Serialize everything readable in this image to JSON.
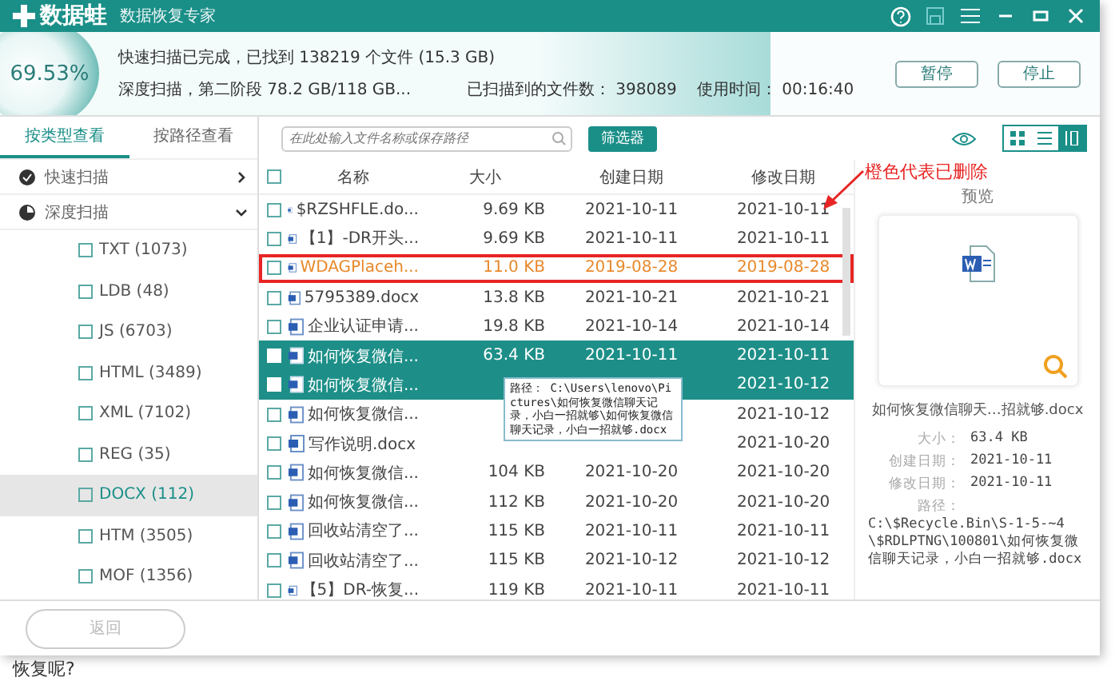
{
  "app": {
    "name": "数据蛙",
    "subtitle": "数据恢复专家"
  },
  "scan": {
    "percent": "69.53%",
    "level": 0.7,
    "line_1": "快速扫描已完成，已找到 138219 个文件 (15.3 GB)",
    "line_2": "深度扫描，第二阶段 78.2 GB/118 GB...",
    "files_scanned": "已扫描到的文件数： 398089",
    "time_used": "使用时间： 00:16:40",
    "buttons": [
      "暂停",
      "停止"
    ]
  },
  "sidebar": {
    "tabs": [
      {
        "label": "按类型查看",
        "selected": true
      },
      {
        "label": "按路径查看",
        "selected": false
      }
    ],
    "tree": [
      {
        "label": "快速扫描",
        "kind": "done",
        "expanded": false
      },
      {
        "label": "深度扫描",
        "kind": "progress",
        "expanded": true,
        "children": [
          {
            "label": "TXT (1073)",
            "selected": false
          },
          {
            "label": "LDB (48)",
            "selected": false
          },
          {
            "label": "JS (6703)",
            "selected": false
          },
          {
            "label": "HTML (3489)",
            "selected": false
          },
          {
            "label": "XML (7102)",
            "selected": false
          },
          {
            "label": "REG (35)",
            "selected": false
          },
          {
            "label": "DOCX (112)",
            "selected": true
          },
          {
            "label": "HTM (3505)",
            "selected": false
          },
          {
            "label": "MOF (1356)",
            "selected": false
          }
        ]
      }
    ]
  },
  "toolbar": {
    "search": {
      "placeholder": "在此处输入文件名称或保存路径"
    },
    "filter": "筛选器",
    "views": [
      {
        "kind": "grid",
        "selected": false
      },
      {
        "kind": "list",
        "selected": false
      },
      {
        "kind": "preview",
        "selected": true
      }
    ]
  },
  "table": {
    "select_all": {
      "checked": false
    },
    "columns": [
      "名称",
      "大小",
      "创建日期",
      "修改日期"
    ],
    "rows": [
      {
        "name": "$RZSHFLE.do...",
        "size": "9.69 KB",
        "created": "2021-10-11",
        "modified": "2021-10-11",
        "selected": false,
        "deleted": false,
        "annotated": false
      },
      {
        "name": "【1】-DR开头...",
        "size": "9.69 KB",
        "created": "2021-10-11",
        "modified": "2021-10-11",
        "selected": false,
        "deleted": false,
        "annotated": false
      },
      {
        "name": "WDAGPlaceh...",
        "size": "11.0 KB",
        "created": "2019-08-28",
        "modified": "2019-08-28",
        "selected": false,
        "deleted": true,
        "annotated": true
      },
      {
        "name": "5795389.docx",
        "size": "13.8 KB",
        "created": "2021-10-21",
        "modified": "2021-10-21",
        "selected": false,
        "deleted": false,
        "annotated": false
      },
      {
        "name": "企业认证申请...",
        "size": "19.8 KB",
        "created": "2021-10-14",
        "modified": "2021-10-14",
        "selected": false,
        "deleted": false,
        "annotated": false
      },
      {
        "name": "如何恢复微信...",
        "size": "63.4 KB",
        "created": "2021-10-11",
        "modified": "2021-10-11",
        "selected": true,
        "deleted": false,
        "annotated": false
      },
      {
        "name": "如何恢复微信...",
        "modified": "2021-10-12",
        "selected": true,
        "deleted": false,
        "annotated": false
      },
      {
        "name": "如何恢复微信...",
        "modified": "2021-10-12",
        "selected": false,
        "deleted": false,
        "annotated": false
      },
      {
        "name": "写作说明.docx",
        "modified": "2021-10-20",
        "selected": false,
        "deleted": false,
        "annotated": false
      },
      {
        "name": "如何恢复微信...",
        "size": "104 KB",
        "created": "2021-10-20",
        "modified": "2021-10-20",
        "selected": false,
        "deleted": false,
        "annotated": false
      },
      {
        "name": "如何恢复微信...",
        "size": "112 KB",
        "created": "2021-10-20",
        "modified": "2021-10-20",
        "selected": false,
        "deleted": false,
        "annotated": false
      },
      {
        "name": "回收站清空了...",
        "size": "115 KB",
        "created": "2021-10-11",
        "modified": "2021-10-11",
        "selected": false,
        "deleted": false,
        "annotated": false
      },
      {
        "name": "回收站清空了...",
        "size": "115 KB",
        "created": "2021-10-12",
        "modified": "2021-10-12",
        "selected": false,
        "deleted": false,
        "annotated": false
      },
      {
        "name": "【5】DR-恢复...",
        "size": "119 KB",
        "created": "2021-10-11",
        "modified": "2021-10-11",
        "selected": false,
        "deleted": false,
        "annotated": false
      }
    ],
    "tooltip": "路径： C:\\Users\\lenovo\\Pictures\\如何恢复微信聊天记录，小白一招就够\\如何恢复微信聊天记录，小白一招就够.docx"
  },
  "annotation": "橙色代表已删除",
  "preview": {
    "title": "预览",
    "filename": "如何恢复微信聊天…招就够.docx",
    "details": [
      {
        "label": "大小：",
        "value": "63.4 KB"
      },
      {
        "label": "创建日期：",
        "value": "2021-10-11"
      },
      {
        "label": "修改日期：",
        "value": "2021-10-11"
      }
    ],
    "path_label": "路径：",
    "path": "C:\\$Recycle.Bin\\S-1-5-~4\\$RDLPTNG\\100801\\如何恢复微信聊天记录，小白一招就够.docx"
  },
  "footer": {
    "back": {
      "label": "返回",
      "disabled": true
    }
  },
  "page_text": "恢复呢?"
}
